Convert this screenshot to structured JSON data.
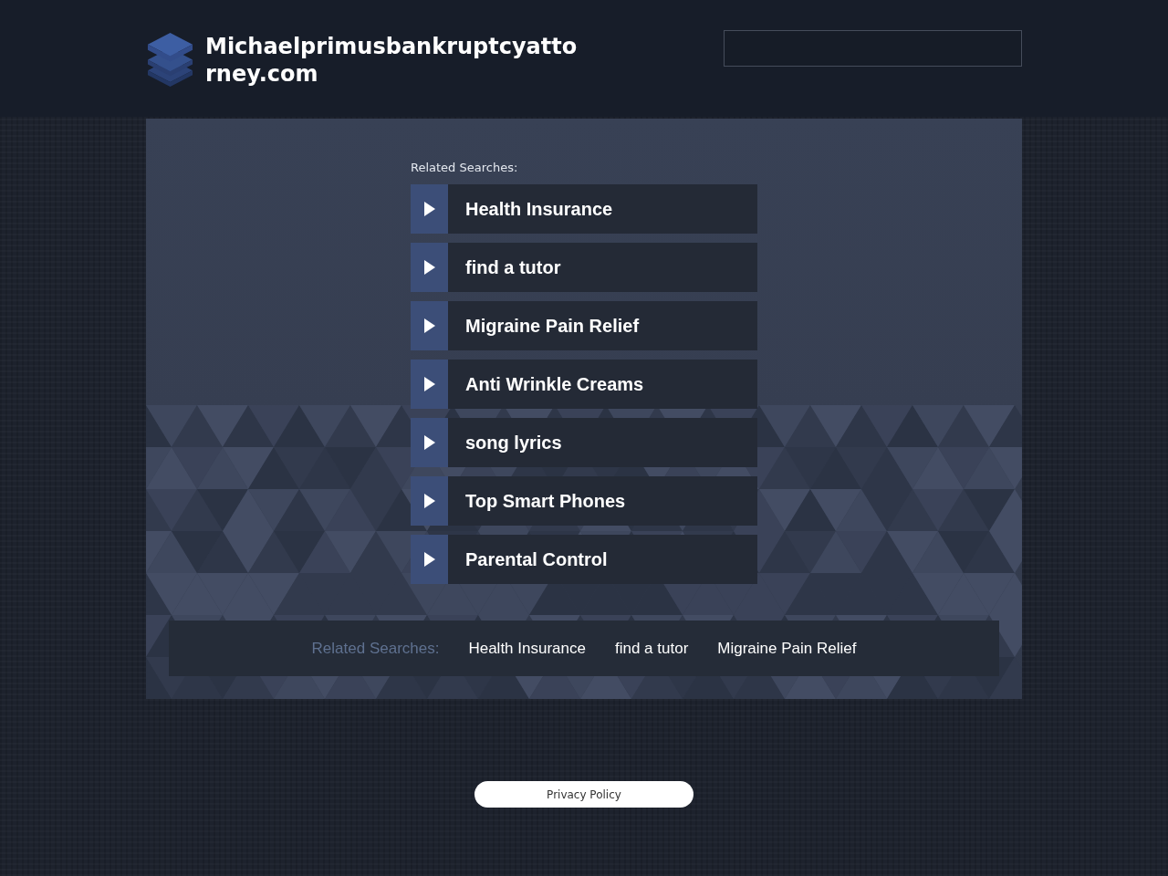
{
  "header": {
    "site_name": "Michaelprimusbankruptcyattorney.com"
  },
  "related_searches": {
    "heading": "Related Searches:",
    "items": [
      "Health Insurance",
      "find a tutor",
      "Migraine Pain Relief",
      "Anti Wrinkle Creams",
      "song lyrics",
      "Top Smart Phones",
      "Parental Control"
    ]
  },
  "footer_links": {
    "heading": "Related Searches:",
    "items": [
      "Health Insurance",
      "find a tutor",
      "Migraine Pain Relief"
    ]
  },
  "privacy_link": "Privacy Policy"
}
